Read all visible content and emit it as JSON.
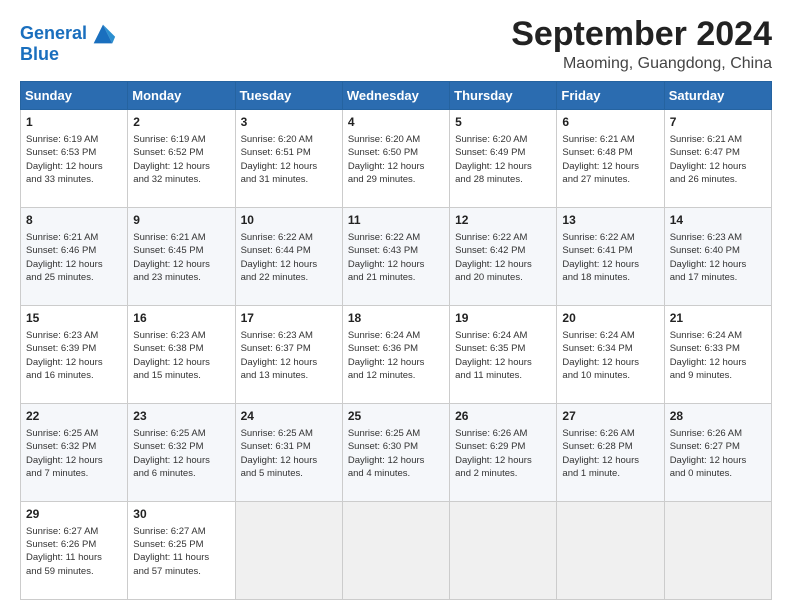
{
  "header": {
    "logo_line1": "General",
    "logo_line2": "Blue",
    "month": "September 2024",
    "location": "Maoming, Guangdong, China"
  },
  "weekdays": [
    "Sunday",
    "Monday",
    "Tuesday",
    "Wednesday",
    "Thursday",
    "Friday",
    "Saturday"
  ],
  "weeks": [
    [
      {
        "day": "1",
        "lines": [
          "Sunrise: 6:19 AM",
          "Sunset: 6:53 PM",
          "Daylight: 12 hours",
          "and 33 minutes."
        ]
      },
      {
        "day": "2",
        "lines": [
          "Sunrise: 6:19 AM",
          "Sunset: 6:52 PM",
          "Daylight: 12 hours",
          "and 32 minutes."
        ]
      },
      {
        "day": "3",
        "lines": [
          "Sunrise: 6:20 AM",
          "Sunset: 6:51 PM",
          "Daylight: 12 hours",
          "and 31 minutes."
        ]
      },
      {
        "day": "4",
        "lines": [
          "Sunrise: 6:20 AM",
          "Sunset: 6:50 PM",
          "Daylight: 12 hours",
          "and 29 minutes."
        ]
      },
      {
        "day": "5",
        "lines": [
          "Sunrise: 6:20 AM",
          "Sunset: 6:49 PM",
          "Daylight: 12 hours",
          "and 28 minutes."
        ]
      },
      {
        "day": "6",
        "lines": [
          "Sunrise: 6:21 AM",
          "Sunset: 6:48 PM",
          "Daylight: 12 hours",
          "and 27 minutes."
        ]
      },
      {
        "day": "7",
        "lines": [
          "Sunrise: 6:21 AM",
          "Sunset: 6:47 PM",
          "Daylight: 12 hours",
          "and 26 minutes."
        ]
      }
    ],
    [
      {
        "day": "8",
        "lines": [
          "Sunrise: 6:21 AM",
          "Sunset: 6:46 PM",
          "Daylight: 12 hours",
          "and 25 minutes."
        ]
      },
      {
        "day": "9",
        "lines": [
          "Sunrise: 6:21 AM",
          "Sunset: 6:45 PM",
          "Daylight: 12 hours",
          "and 23 minutes."
        ]
      },
      {
        "day": "10",
        "lines": [
          "Sunrise: 6:22 AM",
          "Sunset: 6:44 PM",
          "Daylight: 12 hours",
          "and 22 minutes."
        ]
      },
      {
        "day": "11",
        "lines": [
          "Sunrise: 6:22 AM",
          "Sunset: 6:43 PM",
          "Daylight: 12 hours",
          "and 21 minutes."
        ]
      },
      {
        "day": "12",
        "lines": [
          "Sunrise: 6:22 AM",
          "Sunset: 6:42 PM",
          "Daylight: 12 hours",
          "and 20 minutes."
        ]
      },
      {
        "day": "13",
        "lines": [
          "Sunrise: 6:22 AM",
          "Sunset: 6:41 PM",
          "Daylight: 12 hours",
          "and 18 minutes."
        ]
      },
      {
        "day": "14",
        "lines": [
          "Sunrise: 6:23 AM",
          "Sunset: 6:40 PM",
          "Daylight: 12 hours",
          "and 17 minutes."
        ]
      }
    ],
    [
      {
        "day": "15",
        "lines": [
          "Sunrise: 6:23 AM",
          "Sunset: 6:39 PM",
          "Daylight: 12 hours",
          "and 16 minutes."
        ]
      },
      {
        "day": "16",
        "lines": [
          "Sunrise: 6:23 AM",
          "Sunset: 6:38 PM",
          "Daylight: 12 hours",
          "and 15 minutes."
        ]
      },
      {
        "day": "17",
        "lines": [
          "Sunrise: 6:23 AM",
          "Sunset: 6:37 PM",
          "Daylight: 12 hours",
          "and 13 minutes."
        ]
      },
      {
        "day": "18",
        "lines": [
          "Sunrise: 6:24 AM",
          "Sunset: 6:36 PM",
          "Daylight: 12 hours",
          "and 12 minutes."
        ]
      },
      {
        "day": "19",
        "lines": [
          "Sunrise: 6:24 AM",
          "Sunset: 6:35 PM",
          "Daylight: 12 hours",
          "and 11 minutes."
        ]
      },
      {
        "day": "20",
        "lines": [
          "Sunrise: 6:24 AM",
          "Sunset: 6:34 PM",
          "Daylight: 12 hours",
          "and 10 minutes."
        ]
      },
      {
        "day": "21",
        "lines": [
          "Sunrise: 6:24 AM",
          "Sunset: 6:33 PM",
          "Daylight: 12 hours",
          "and 9 minutes."
        ]
      }
    ],
    [
      {
        "day": "22",
        "lines": [
          "Sunrise: 6:25 AM",
          "Sunset: 6:32 PM",
          "Daylight: 12 hours",
          "and 7 minutes."
        ]
      },
      {
        "day": "23",
        "lines": [
          "Sunrise: 6:25 AM",
          "Sunset: 6:32 PM",
          "Daylight: 12 hours",
          "and 6 minutes."
        ]
      },
      {
        "day": "24",
        "lines": [
          "Sunrise: 6:25 AM",
          "Sunset: 6:31 PM",
          "Daylight: 12 hours",
          "and 5 minutes."
        ]
      },
      {
        "day": "25",
        "lines": [
          "Sunrise: 6:25 AM",
          "Sunset: 6:30 PM",
          "Daylight: 12 hours",
          "and 4 minutes."
        ]
      },
      {
        "day": "26",
        "lines": [
          "Sunrise: 6:26 AM",
          "Sunset: 6:29 PM",
          "Daylight: 12 hours",
          "and 2 minutes."
        ]
      },
      {
        "day": "27",
        "lines": [
          "Sunrise: 6:26 AM",
          "Sunset: 6:28 PM",
          "Daylight: 12 hours",
          "and 1 minute."
        ]
      },
      {
        "day": "28",
        "lines": [
          "Sunrise: 6:26 AM",
          "Sunset: 6:27 PM",
          "Daylight: 12 hours",
          "and 0 minutes."
        ]
      }
    ],
    [
      {
        "day": "29",
        "lines": [
          "Sunrise: 6:27 AM",
          "Sunset: 6:26 PM",
          "Daylight: 11 hours",
          "and 59 minutes."
        ]
      },
      {
        "day": "30",
        "lines": [
          "Sunrise: 6:27 AM",
          "Sunset: 6:25 PM",
          "Daylight: 11 hours",
          "and 57 minutes."
        ]
      },
      {
        "day": "",
        "lines": []
      },
      {
        "day": "",
        "lines": []
      },
      {
        "day": "",
        "lines": []
      },
      {
        "day": "",
        "lines": []
      },
      {
        "day": "",
        "lines": []
      }
    ]
  ]
}
